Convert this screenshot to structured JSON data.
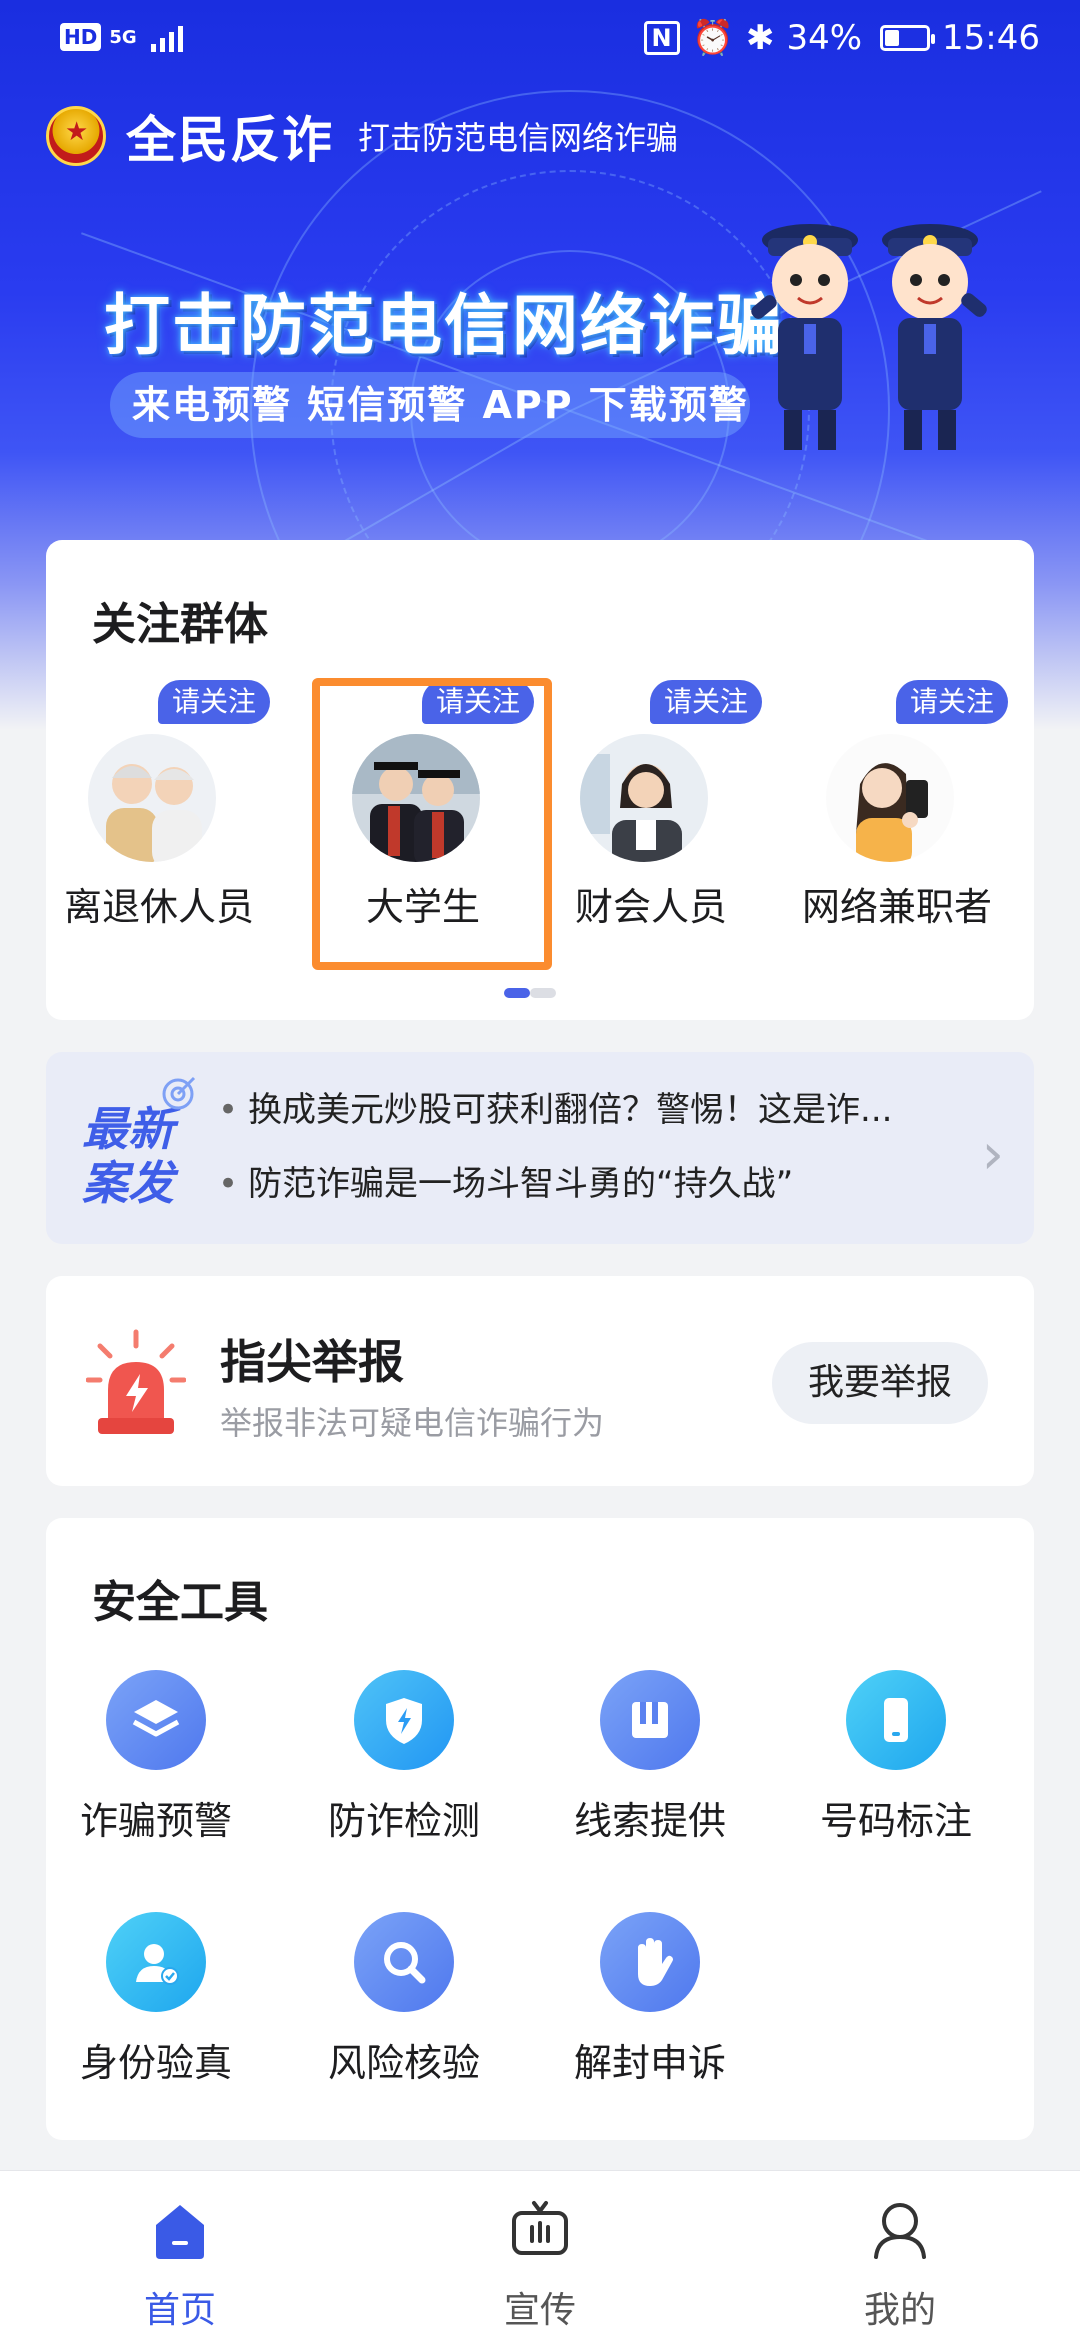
{
  "status_bar": {
    "hd": "HD",
    "network": "5G",
    "battery": "34%",
    "battery_level": 0.34,
    "time": "15:46"
  },
  "app": {
    "name": "全民反诈",
    "slogan": "打击防范电信网络诈骗"
  },
  "banner": {
    "headline": "打击防范电信网络诈骗",
    "subline": "来电预警 短信预警 APP 下载预警"
  },
  "focus_groups": {
    "title": "关注群体",
    "tag": "请关注",
    "items": [
      {
        "label": "离退休人员",
        "icon": "elderly-couple-avatar"
      },
      {
        "label": "大学生",
        "icon": "graduates-avatar",
        "selected": true
      },
      {
        "label": "财会人员",
        "icon": "accountant-avatar"
      },
      {
        "label": "网络兼职者",
        "icon": "online-worker-avatar"
      }
    ],
    "page_index": 0,
    "page_count": 2
  },
  "news": {
    "badge_line1": "最新",
    "badge_line2": "案发",
    "items": [
      "换成美元炒股可获利翻倍？警惕！这是诈...",
      "防范诈骗是一场斗智斗勇的“持久战”"
    ]
  },
  "report": {
    "title": "指尖举报",
    "subtitle": "举报非法可疑电信诈骗行为",
    "button": "我要举报"
  },
  "tools": {
    "title": "安全工具",
    "items": [
      {
        "label": "诈骗预警",
        "icon": "layers-icon"
      },
      {
        "label": "防诈检测",
        "icon": "shield-bolt-icon"
      },
      {
        "label": "线索提供",
        "icon": "book-icon"
      },
      {
        "label": "号码标注",
        "icon": "phone-icon"
      },
      {
        "label": "身份验真",
        "icon": "id-verify-icon"
      },
      {
        "label": "风险核验",
        "icon": "search-icon"
      },
      {
        "label": "解封申诉",
        "icon": "hand-icon"
      }
    ]
  },
  "nav": {
    "items": [
      {
        "label": "首页",
        "icon": "home-icon",
        "active": true
      },
      {
        "label": "宣传",
        "icon": "tv-icon",
        "active": false
      },
      {
        "label": "我的",
        "icon": "user-icon",
        "active": false
      }
    ]
  },
  "colors": {
    "brand_blue": "#1a2ee0",
    "accent_blue": "#4a63e8",
    "highlight_orange": "#fb8c2f",
    "tool_icon_blue": "#5b8ef5",
    "tool_icon_cyan": "#2fb8f3",
    "report_red": "#f0564f"
  }
}
